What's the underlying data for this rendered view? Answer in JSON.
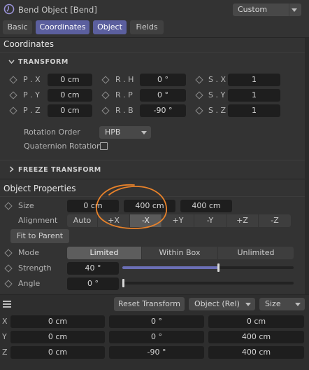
{
  "header": {
    "title": "Bend Object [Bend]",
    "preset": "Custom"
  },
  "tabs": [
    {
      "label": "Basic",
      "active": false
    },
    {
      "label": "Coordinates",
      "active": true
    },
    {
      "label": "Object",
      "active": true
    },
    {
      "label": "Fields",
      "active": false
    }
  ],
  "coordinates": {
    "section_title": "Coordinates",
    "transform_label": "TRANSFORM",
    "rows": [
      {
        "p_label": "P . X",
        "p_value": "0 cm",
        "r_label": "R . H",
        "r_value": "0 °",
        "s_label": "S . X",
        "s_value": "1"
      },
      {
        "p_label": "P . Y",
        "p_value": "0 cm",
        "r_label": "R . P",
        "r_value": "0 °",
        "s_label": "S . Y",
        "s_value": "1"
      },
      {
        "p_label": "P . Z",
        "p_value": "0 cm",
        "r_label": "R . B",
        "r_value": "-90 °",
        "s_label": "S . Z",
        "s_value": "1"
      }
    ],
    "rotation_order_label": "Rotation Order",
    "rotation_order_value": "HPB",
    "quaternion_label": "Quaternion Rotation",
    "freeze_label": "FREEZE TRANSFORM"
  },
  "object": {
    "section_title": "Object Properties",
    "size_label": "Size",
    "size_values": [
      "0 cm",
      "400 cm",
      "400 cm"
    ],
    "alignment_label": "Alignment",
    "alignment_options": [
      "Auto",
      "+X",
      "-X",
      "+Y",
      "-Y",
      "+Z",
      "-Z"
    ],
    "alignment_selected": "-X",
    "fit_button": "Fit to Parent",
    "mode_label": "Mode",
    "mode_options": [
      "Limited",
      "Within Box",
      "Unlimited"
    ],
    "mode_selected": "Limited",
    "strength_label": "Strength",
    "strength_value": "40 °",
    "strength_fraction": 0.56,
    "angle_label": "Angle",
    "angle_value": "0 °",
    "angle_fraction": 0.0
  },
  "bottom": {
    "reset_button": "Reset Transform",
    "coord_mode": "Object (Rel)",
    "size_mode": "Size",
    "rows": [
      {
        "axis": "X",
        "pos": "0 cm",
        "rot": "0 °",
        "size": "0 cm"
      },
      {
        "axis": "Y",
        "pos": "0 cm",
        "rot": "0 °",
        "size": "400 cm"
      },
      {
        "axis": "Z",
        "pos": "0 cm",
        "rot": "-90 °",
        "size": "400 cm"
      }
    ]
  },
  "colors": {
    "accent": "#5b5f9e",
    "annotation": "#e8822a",
    "panel": "#333333",
    "field": "#1e1e1e"
  }
}
